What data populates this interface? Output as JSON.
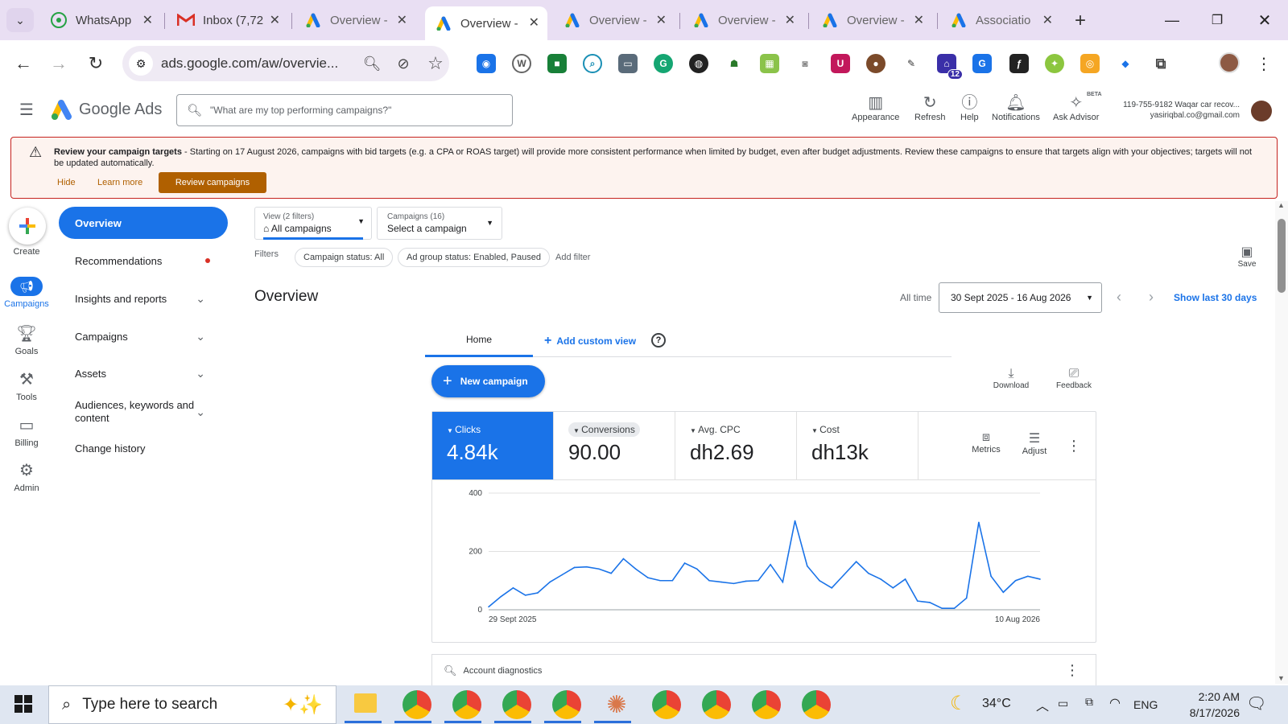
{
  "tabs": [
    {
      "title": "WhatsApp",
      "icon": "whatsapp-icon"
    },
    {
      "title": "Inbox (7,72",
      "icon": "gmail-icon"
    },
    {
      "title": "Overview -",
      "icon": "google-ads-icon"
    },
    {
      "title": "Overview -",
      "icon": "google-ads-icon",
      "active": true
    },
    {
      "title": "Overview -",
      "icon": "google-ads-icon"
    },
    {
      "title": "Overview -",
      "icon": "google-ads-icon"
    },
    {
      "title": "Overview -",
      "icon": "google-ads-icon"
    },
    {
      "title": "Associatio",
      "icon": "google-ads-icon"
    }
  ],
  "toolbar": {
    "url": "ads.google.com/aw/overvie...",
    "extension_badge": "12"
  },
  "ads_header": {
    "product": "Google Ads",
    "search_placeholder": "\"What are my top performing campaigns?\"",
    "buttons": [
      "Appearance",
      "Refresh",
      "Help",
      "Notifications",
      "Ask Advisor"
    ],
    "beta_label": "BETA",
    "account_line1": "119-755-9182 Waqar car recov...",
    "account_line2": "yasiriqbal.co@gmail.com"
  },
  "banner": {
    "title": "Review your campaign targets",
    "text": " - Starting on 17 August 2026, campaigns with bid targets (e.g. a CPA or ROAS target) will provide more consistent performance when limited by budget, even after budget adjustments. Review these campaigns to ensure that targets align with your objectives; targets will not be updated automatically.",
    "hide": "Hide",
    "learn_more": "Learn more",
    "review": "Review campaigns"
  },
  "rail": [
    "Create",
    "Campaigns",
    "Goals",
    "Tools",
    "Billing",
    "Admin"
  ],
  "nav": {
    "overview": "Overview",
    "items": [
      "Recommendations",
      "Insights and reports",
      "Campaigns",
      "Assets",
      "Audiences, keywords and content",
      "Change history"
    ]
  },
  "filters": {
    "view_label": "View (2 filters)",
    "view_value": "All campaigns",
    "campaigns_label": "Campaigns (16)",
    "campaigns_value": "Select a campaign",
    "filters_label": "Filters",
    "chip1": "Campaign status: All",
    "chip2": "Ad group status: Enabled, Paused",
    "add_filter": "Add filter",
    "save": "Save"
  },
  "overview": {
    "title": "Overview",
    "all_time": "All time",
    "date_range": "30 Sept 2025 - 16 Aug 2026",
    "show_last": "Show last 30 days",
    "tab_home": "Home",
    "add_custom_view": "Add custom view",
    "new_campaign": "New campaign",
    "download": "Download",
    "feedback": "Feedback",
    "metrics_btn": "Metrics",
    "adjust_btn": "Adjust",
    "account_diagnostics": "Account diagnostics"
  },
  "metrics": [
    {
      "label": "Clicks",
      "value": "4.84k",
      "color": "#1a73e8"
    },
    {
      "label": "Conversions",
      "value": "90.00"
    },
    {
      "label": "Avg. CPC",
      "value": "dh2.69"
    },
    {
      "label": "Cost",
      "value": "dh13k"
    }
  ],
  "chart_data": {
    "type": "line",
    "series": [
      {
        "values": [
          10,
          45,
          75,
          50,
          58,
          95,
          120,
          145,
          147,
          140,
          125,
          175,
          140,
          110,
          100,
          100,
          160,
          140,
          100,
          95,
          90,
          98,
          100,
          155,
          95,
          305,
          150,
          100,
          75,
          120,
          165,
          125,
          105,
          75,
          105,
          30,
          25,
          5,
          5,
          40,
          300,
          115,
          60,
          100,
          115,
          105
        ]
      }
    ],
    "ylim": [
      0,
      400
    ],
    "yticks": [
      "0",
      "200",
      "400"
    ],
    "xticks": [
      "29 Sept 2025",
      "10 Aug 2026"
    ],
    "grid": true,
    "color": "#1a73e8"
  },
  "taskbar": {
    "search_placeholder": "Type here to search",
    "temperature": "34°C",
    "lang": "ENG",
    "time": "2:20 AM",
    "date": "8/17/2026"
  }
}
